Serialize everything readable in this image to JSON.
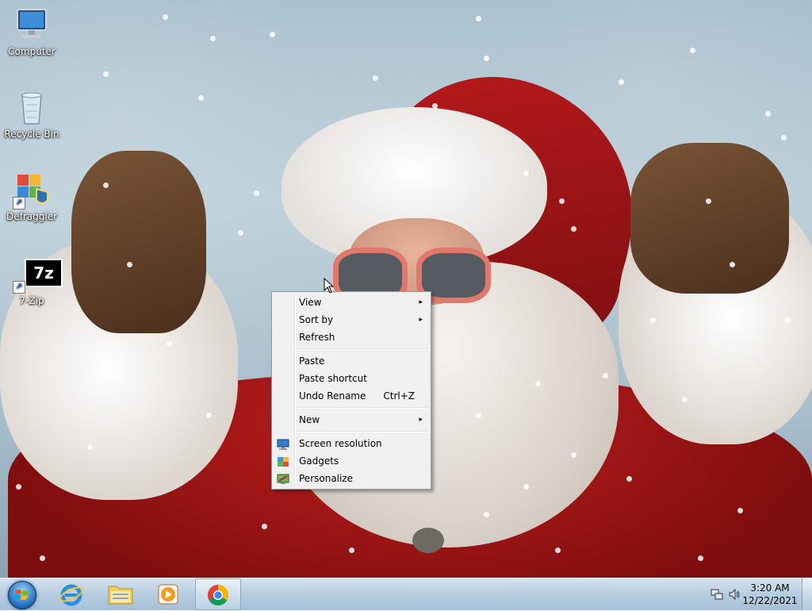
{
  "desktop_icons": [
    {
      "label": "Computer",
      "icon": "computer-icon"
    },
    {
      "label": "Recycle Bin",
      "icon": "recycle-bin-icon"
    },
    {
      "label": "Defraggler",
      "icon": "defraggler-icon"
    },
    {
      "label": "7-Zip",
      "icon": "7zip-icon",
      "glyph": "7z"
    }
  ],
  "context_menu": {
    "items": [
      {
        "label": "View",
        "submenu": true
      },
      {
        "label": "Sort by",
        "submenu": true
      },
      {
        "label": "Refresh"
      },
      {
        "label": "Paste"
      },
      {
        "label": "Paste shortcut"
      },
      {
        "label": "Undo Rename",
        "shortcut": "Ctrl+Z"
      },
      {
        "label": "New",
        "submenu": true
      },
      {
        "label": "Screen resolution",
        "icon": "screen-resolution-icon"
      },
      {
        "label": "Gadgets",
        "icon": "gadgets-icon"
      },
      {
        "label": "Personalize",
        "icon": "personalize-icon"
      }
    ],
    "submenu_arrow": "▸"
  },
  "taskbar": {
    "start_icon": "windows-start-orb-icon",
    "pinned": [
      {
        "icon": "internet-explorer-icon"
      },
      {
        "icon": "file-explorer-icon"
      },
      {
        "icon": "media-player-icon"
      },
      {
        "icon": "chrome-icon",
        "active": true
      }
    ],
    "tray_icons": [
      "network-icon",
      "volume-icon"
    ]
  },
  "clock": {
    "time": "3:20 AM",
    "date": "12/22/2021"
  }
}
